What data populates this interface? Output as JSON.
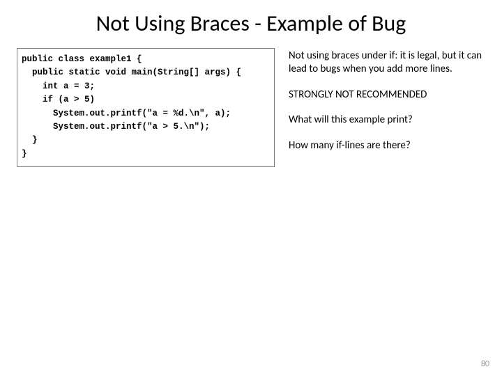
{
  "title": "Not Using Braces - Example of Bug",
  "code": "public class example1 {\n  public static void main(String[] args) {\n    int a = 3;\n    if (a > 5)\n      System.out.printf(\"a = %d.\\n\", a);\n      System.out.printf(\"a > 5.\\n\");\n  }\n}",
  "right": {
    "p1": "Not using braces under if: it is legal, but it can lead to bugs when you add more lines.",
    "p2": "STRONGLY NOT RECOMMENDED",
    "p3": "What will this example print?",
    "p4": "How many if-lines are there?"
  },
  "page_number": "80"
}
